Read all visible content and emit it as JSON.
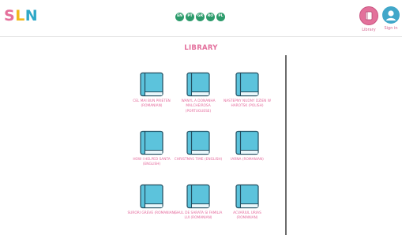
{
  "header": {
    "logo": [
      "S",
      "L",
      "N"
    ],
    "languages": [
      "EN",
      "PT",
      "GR",
      "RO",
      "PL"
    ],
    "library_label": "Library",
    "signin_label": "Sign in"
  },
  "main": {
    "title": "LIBRARY",
    "books": [
      {
        "title": "CEL MAI BUN PRIETEN (ROMANIAN)"
      },
      {
        "title": "WANYL A DONANHA MALCHEIROSA (PORTUGUESE)"
      },
      {
        "title": "NASTEPNY NUDNY DZIEN W HAROTSK (POLISH)"
      },
      {
        "title": "HOW I HELPED SANTA (ENGLISH)"
      },
      {
        "title": "CHRISTMAS TIME (ENGLISH)"
      },
      {
        "title": "IARNA (ROMANIAN)"
      },
      {
        "title": "SURORI GREVE (ROMANIAN)"
      },
      {
        "title": "GHUL DE SARATA SI FAMILIA LUI (ROMANIAN)"
      },
      {
        "title": "ACVARIUL URIAS (ROMANIAN)"
      }
    ]
  },
  "colors": {
    "accent_pink": "#e36f9c",
    "book_blue": "#5cc3dc",
    "lang_green": "#2c9b6b",
    "signin_blue": "#41a7c9"
  }
}
